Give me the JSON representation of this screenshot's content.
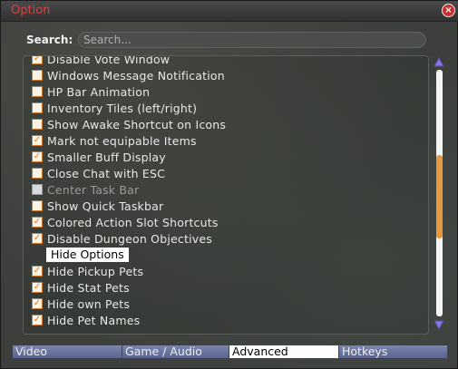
{
  "window": {
    "title": "Option",
    "close_icon_glyph": "×"
  },
  "search": {
    "label": "Search:",
    "placeholder": "Search...",
    "value": ""
  },
  "options": [
    {
      "label": "Disable Vote Window",
      "checked": true,
      "enabled": true
    },
    {
      "label": "Windows Message Notification",
      "checked": false,
      "enabled": true
    },
    {
      "label": "HP Bar Animation",
      "checked": false,
      "enabled": true
    },
    {
      "label": "Inventory Tiles (left/right)",
      "checked": false,
      "enabled": true
    },
    {
      "label": "Show Awake Shortcut on Icons",
      "checked": false,
      "enabled": true
    },
    {
      "label": "Mark not equipable Items",
      "checked": true,
      "enabled": true
    },
    {
      "label": "Smaller Buff Display",
      "checked": true,
      "enabled": true
    },
    {
      "label": "Close Chat with ESC",
      "checked": false,
      "enabled": true
    },
    {
      "label": "Center Task Bar",
      "checked": false,
      "enabled": false
    },
    {
      "label": "Show Quick Taskbar",
      "checked": false,
      "enabled": true
    },
    {
      "label": "Colored Action Slot Shortcuts",
      "checked": true,
      "enabled": true
    },
    {
      "label": "Disable Dungeon Objectives",
      "checked": true,
      "enabled": true
    },
    {
      "section": "Hide Options"
    },
    {
      "label": "Hide Pickup Pets",
      "checked": true,
      "enabled": true
    },
    {
      "label": "Hide Stat Pets",
      "checked": true,
      "enabled": true
    },
    {
      "label": "Hide own Pets",
      "checked": true,
      "enabled": true
    },
    {
      "label": "Hide Pet Names",
      "checked": true,
      "enabled": true
    }
  ],
  "tabs": [
    {
      "label": "Video",
      "active": false
    },
    {
      "label": "Game / Audio",
      "active": false
    },
    {
      "label": "Advanced",
      "active": true
    },
    {
      "label": "Hotkeys",
      "active": false
    }
  ],
  "colors": {
    "title": "#d94040",
    "checkbox_border": "#c87a2a",
    "scroll_thumb": "#e69a3c",
    "tab_bar": "#6a74a0",
    "scroll_arrow": "#8a7ad8"
  },
  "icons": {
    "scroll_up": "triangle-up-icon",
    "scroll_down": "triangle-down-icon",
    "close": "close-icon"
  }
}
